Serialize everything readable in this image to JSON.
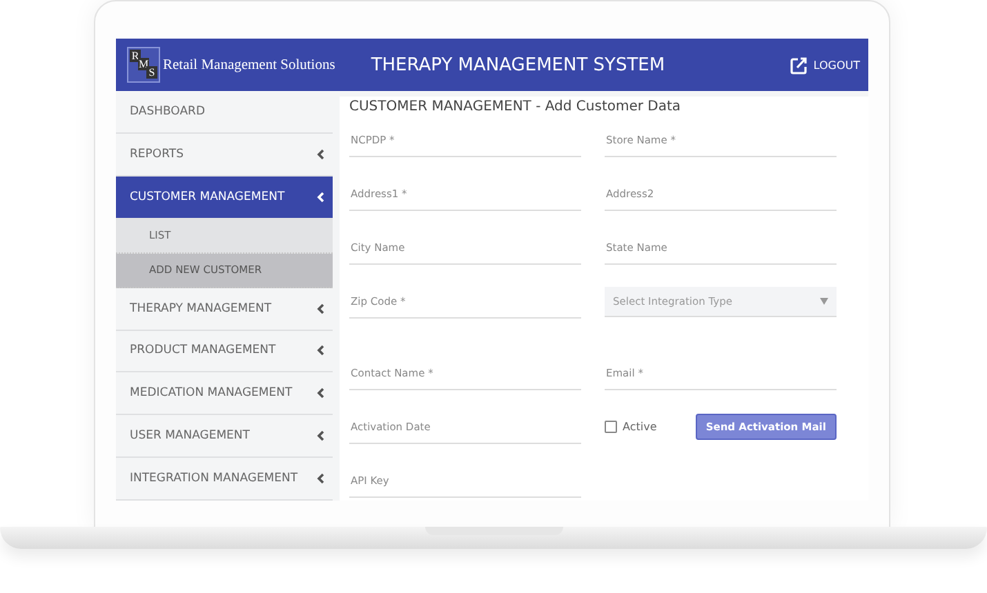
{
  "header": {
    "logo_letters": [
      "R",
      "M",
      "S"
    ],
    "logo_text": "Retail Management Solutions",
    "title": "THERAPY MANAGEMENT SYSTEM",
    "logout": "LOGOUT"
  },
  "sidebar": {
    "items": [
      {
        "label": "DASHBOARD",
        "selected": false,
        "expandable": false
      },
      {
        "label": "REPORTS",
        "selected": false,
        "expandable": true
      },
      {
        "label": "CUSTOMER MANAGEMENT",
        "selected": true,
        "expandable": true,
        "children": [
          {
            "label": "LIST",
            "selected": false
          },
          {
            "label": "ADD NEW CUSTOMER",
            "selected": true
          }
        ]
      },
      {
        "label": "THERAPY MANAGEMENT",
        "selected": false,
        "expandable": true
      },
      {
        "label": "PRODUCT MANAGEMENT",
        "selected": false,
        "expandable": true
      },
      {
        "label": "MEDICATION MANAGEMENT",
        "selected": false,
        "expandable": true
      },
      {
        "label": "USER MANAGEMENT",
        "selected": false,
        "expandable": true
      },
      {
        "label": "INTEGRATION MANAGEMENT",
        "selected": false,
        "expandable": true
      }
    ]
  },
  "form": {
    "title": "CUSTOMER MANAGEMENT - Add Customer Data",
    "fields": [
      {
        "kind": "text",
        "placeholder": "NCPDP *"
      },
      {
        "kind": "text",
        "placeholder": "Store Name *"
      },
      {
        "kind": "text",
        "placeholder": "Address1 *"
      },
      {
        "kind": "text",
        "placeholder": "Address2"
      },
      {
        "kind": "text",
        "placeholder": "City Name"
      },
      {
        "kind": "text",
        "placeholder": "State Name"
      },
      {
        "kind": "text",
        "placeholder": "Zip Code *"
      },
      {
        "kind": "select",
        "placeholder": "Select Integration Type"
      },
      {
        "kind": "text",
        "placeholder": "Contact Name *"
      },
      {
        "kind": "text",
        "placeholder": "Email *"
      },
      {
        "kind": "text",
        "placeholder": "Activation Date"
      },
      {
        "kind": "action",
        "checkbox": {
          "label": "Active",
          "checked": false
        },
        "button": "Send Activation Mail"
      },
      {
        "kind": "text",
        "placeholder": "API Key"
      }
    ]
  }
}
